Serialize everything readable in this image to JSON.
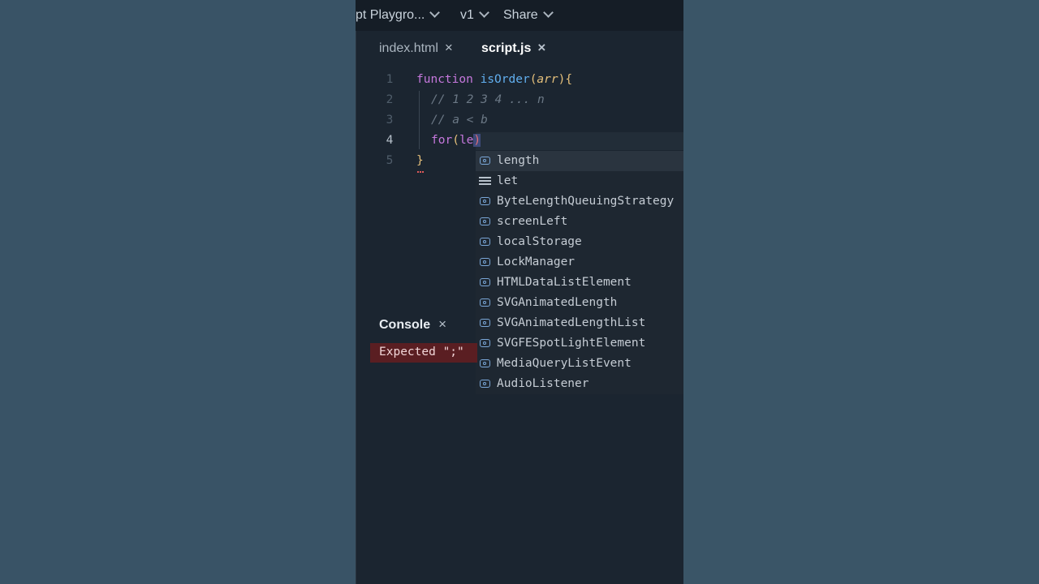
{
  "topbar": {
    "project_name": "pt Playgro...",
    "version": "v1",
    "share": "Share"
  },
  "tabs": [
    {
      "label": "index.html",
      "close": "×",
      "active": false
    },
    {
      "label": "script.js",
      "close": "×",
      "active": true
    }
  ],
  "editor": {
    "line_numbers": [
      "1",
      "2",
      "3",
      "4",
      "5"
    ],
    "line1": {
      "kw": "function",
      "fn": "isOrder",
      "open": "(",
      "arg": "arr",
      "close": "){"
    },
    "line2": "// 1 2 3 4 ... n",
    "line3": "// a < b",
    "line4": {
      "kw": "for",
      "paren": "(",
      "typed": "le",
      "close": ")"
    },
    "line5": "}"
  },
  "suggestions": [
    {
      "label": "length",
      "kind": "property",
      "selected": true
    },
    {
      "label": "let",
      "kind": "keyword",
      "selected": false
    },
    {
      "label": "ByteLengthQueuingStrategy",
      "kind": "property",
      "selected": false
    },
    {
      "label": "screenLeft",
      "kind": "property",
      "selected": false
    },
    {
      "label": "localStorage",
      "kind": "property",
      "selected": false
    },
    {
      "label": "LockManager",
      "kind": "property",
      "selected": false
    },
    {
      "label": "HTMLDataListElement",
      "kind": "property",
      "selected": false
    },
    {
      "label": "SVGAnimatedLength",
      "kind": "property",
      "selected": false
    },
    {
      "label": "SVGAnimatedLengthList",
      "kind": "property",
      "selected": false
    },
    {
      "label": "SVGFESpotLightElement",
      "kind": "property",
      "selected": false
    },
    {
      "label": "MediaQueryListEvent",
      "kind": "property",
      "selected": false
    },
    {
      "label": "AudioListener",
      "kind": "property",
      "selected": false
    }
  ],
  "console": {
    "title": "Console",
    "close": "×",
    "error": "Expected \";\""
  },
  "colors": {
    "background": "#3a5568",
    "editor_bg": "#1b2530",
    "keyword": "#c678dd",
    "function": "#61afef",
    "error_bg": "#5a1e22"
  }
}
